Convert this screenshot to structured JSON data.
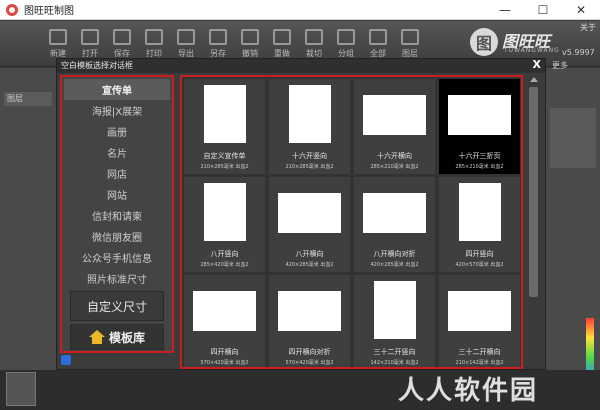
{
  "window": {
    "title": "图旺旺制图",
    "controls": [
      "—",
      "☐",
      "✕"
    ]
  },
  "toolbar": {
    "buttons": [
      "新建",
      "打开",
      "保存",
      "打印",
      "导出",
      "另存",
      "撤销",
      "重做",
      "裁切",
      "分组",
      "全部",
      "图层"
    ]
  },
  "logo": {
    "text": "图旺旺",
    "sub": "TUWANGWANG",
    "version": "v5.9997"
  },
  "top_menu": [
    "关于"
  ],
  "bg": {
    "more": "更多",
    "layers": "图层"
  },
  "dialog": {
    "title": "空白模板选择对话框",
    "close": "X",
    "categories": [
      "宣传单",
      "海报|X展架",
      "画册",
      "名片",
      "网店",
      "网站",
      "信封和请柬",
      "微信朋友圈",
      "公众号手机信息",
      "照片标准尺寸"
    ],
    "custom_size_label": "自定义尺寸",
    "library_label": "模板库",
    "templates": [
      {
        "name": "自定义宣传单",
        "size": "210×285毫米  出血2",
        "orientation": "portrait"
      },
      {
        "name": "十六开竖向",
        "size": "210×285毫米  出血2",
        "orientation": "portrait"
      },
      {
        "name": "十六开横向",
        "size": "285×210毫米  出血2",
        "orientation": "landscape"
      },
      {
        "name": "十六开三折页",
        "size": "285×210毫米  出血2",
        "orientation": "landscape"
      },
      {
        "name": "八开竖向",
        "size": "285×420毫米  出血2",
        "orientation": "portrait"
      },
      {
        "name": "八开横向",
        "size": "420×285毫米  出血2",
        "orientation": "landscape"
      },
      {
        "name": "八开横向对折",
        "size": "420×285毫米  出血2",
        "orientation": "landscape"
      },
      {
        "name": "四开竖向",
        "size": "420×570毫米  出血2",
        "orientation": "portrait"
      },
      {
        "name": "四开横向",
        "size": "570×420毫米  出血2",
        "orientation": "landscape"
      },
      {
        "name": "四开横向对折",
        "size": "570×420毫米  出血2",
        "orientation": "landscape"
      },
      {
        "name": "三十二开竖向",
        "size": "142×210毫米  出血2",
        "orientation": "portrait"
      },
      {
        "name": "三十二开横向",
        "size": "210×142毫米  出血2",
        "orientation": "landscape"
      }
    ],
    "selected_index": 3
  },
  "watermark": "人人软件园",
  "colors": {
    "accent_border": "#c81e1e",
    "selected_bg": "#000000"
  }
}
